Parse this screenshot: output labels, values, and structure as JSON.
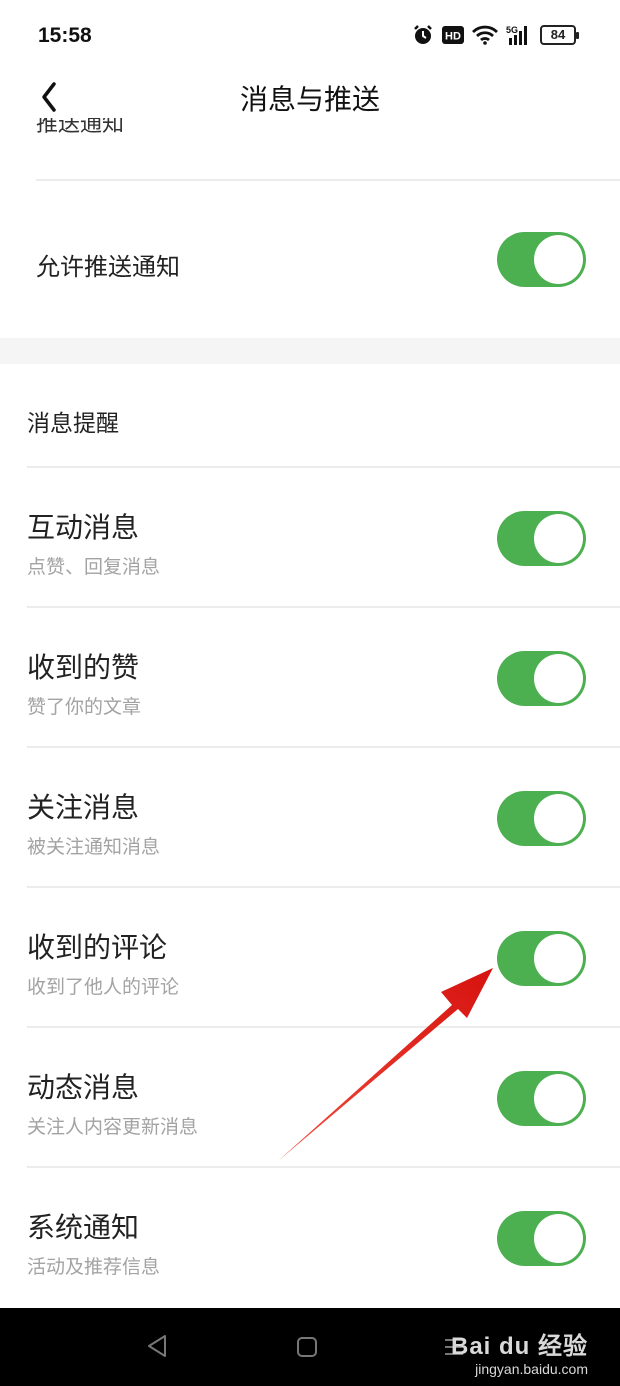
{
  "status_bar": {
    "time": "15:58",
    "icons": [
      "alarm-icon",
      "hd-icon",
      "wifi-icon",
      "5g-signal-icon"
    ],
    "battery": "84"
  },
  "header": {
    "title": "消息与推送",
    "back_icon": "back-chevron-icon"
  },
  "push_section": {
    "partial_label": "推送通知",
    "allow_label": "允许推送通知",
    "allow_enabled": true
  },
  "reminder_section": {
    "title": "消息提醒",
    "items": [
      {
        "title": "互动消息",
        "subtitle": "点赞、回复消息",
        "enabled": true
      },
      {
        "title": "收到的赞",
        "subtitle": "赞了你的文章",
        "enabled": true
      },
      {
        "title": "关注消息",
        "subtitle": "被关注通知消息",
        "enabled": true
      },
      {
        "title": "收到的评论",
        "subtitle": "收到了他人的评论",
        "enabled": true
      },
      {
        "title": "动态消息",
        "subtitle": "关注人内容更新消息",
        "enabled": true
      },
      {
        "title": "系统通知",
        "subtitle": "活动及推荐信息",
        "enabled": true
      }
    ]
  },
  "colors": {
    "toggle_on": "#4caf50",
    "arrow": "#e8211f"
  },
  "system_nav": {
    "icons": [
      "nav-back-icon",
      "nav-home-icon",
      "nav-menu-icon"
    ]
  },
  "watermark": {
    "main": "Bai du 经验",
    "sub": "jingyan.baidu.com"
  }
}
